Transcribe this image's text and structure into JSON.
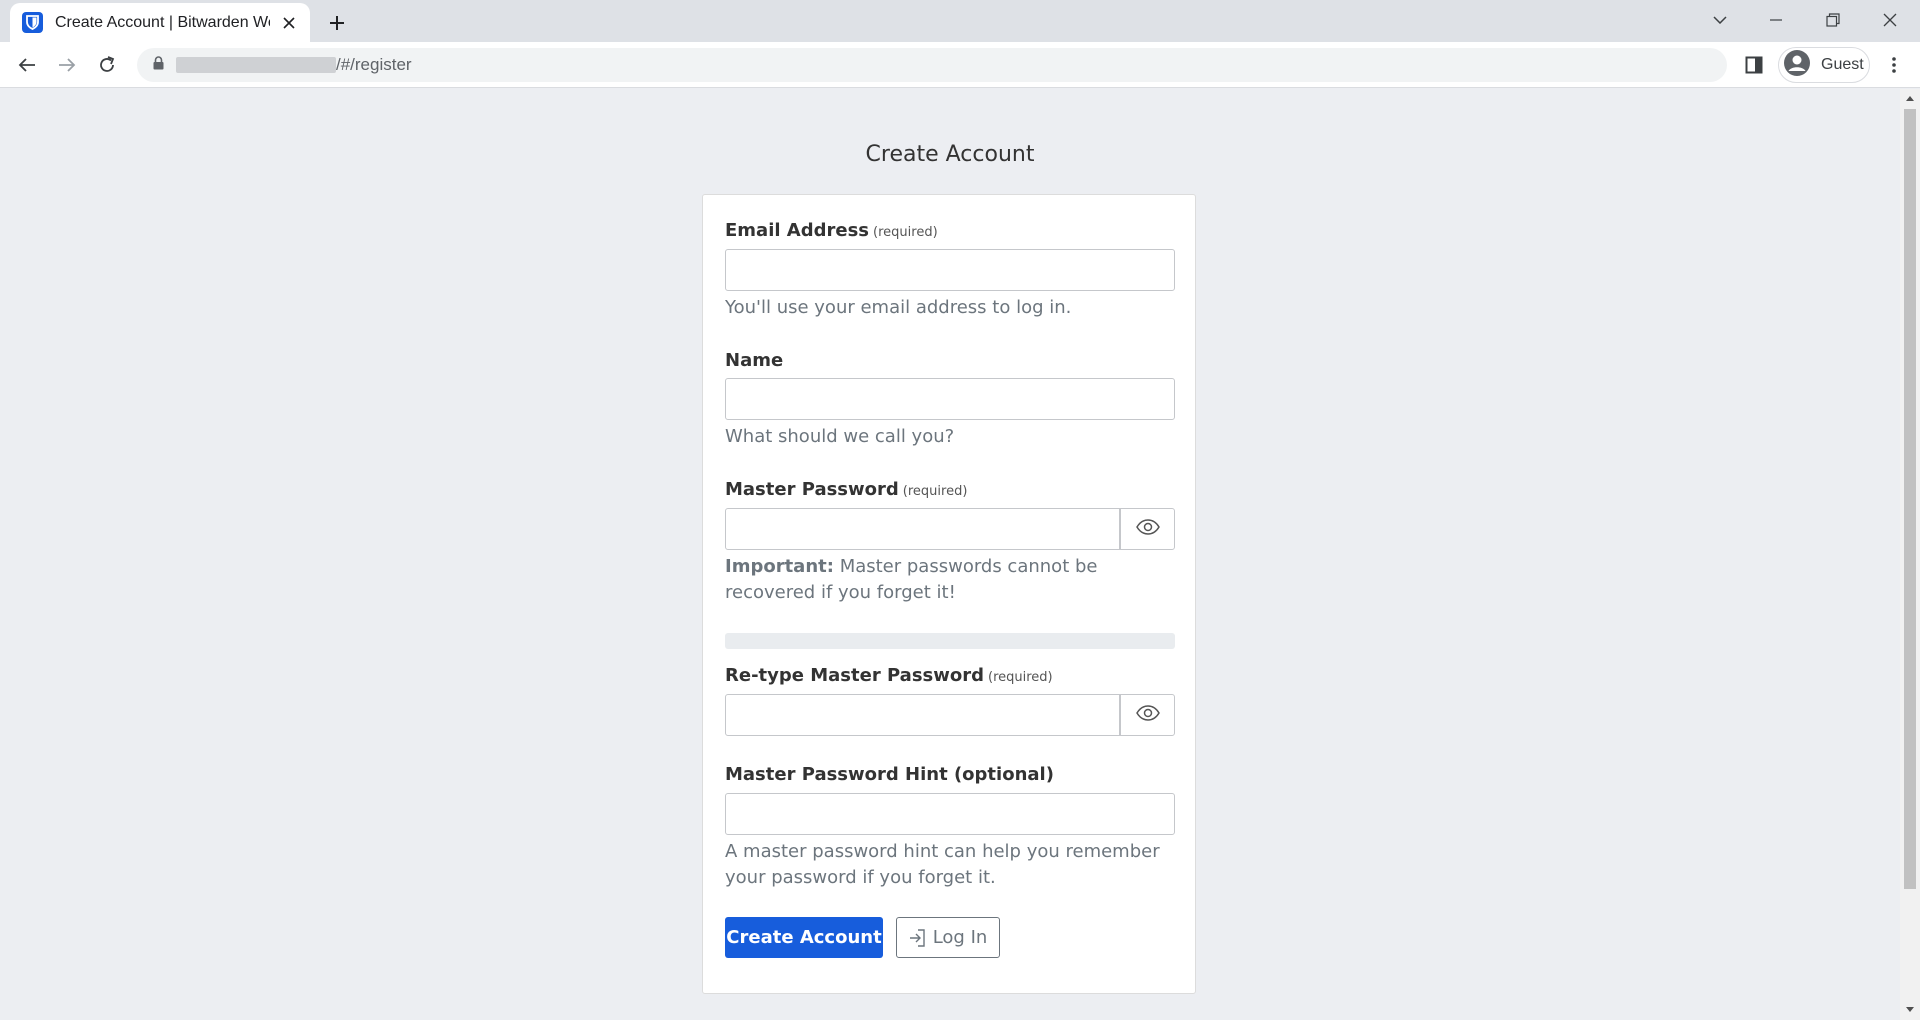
{
  "browser": {
    "tab_title": "Create Account | Bitwarden Web",
    "url_path": "/#/register",
    "profile_label": "Guest"
  },
  "page": {
    "title": "Create Account"
  },
  "form": {
    "email_label": "Email Address",
    "email_required": "(required)",
    "email_value": "",
    "email_help": "You'll use your email address to log in.",
    "name_label": "Name",
    "name_value": "",
    "name_help": "What should we call you?",
    "master_password_label": "Master Password",
    "master_password_required": "(required)",
    "master_password_value": "",
    "master_password_help_strong": "Important:",
    "master_password_help": "Master passwords cannot be recovered if you forget it!",
    "password_strength": 0,
    "retype_label": "Re-type Master Password",
    "retype_required": "(required)",
    "retype_value": "",
    "hint_label": "Master Password Hint (optional)",
    "hint_value": "",
    "hint_help": "A master password hint can help you remember your password if you forget it.",
    "create_button": "Create Account",
    "login_button": "Log In"
  },
  "colors": {
    "primary": "#175ddc",
    "background": "#eceef2",
    "muted_text": "#6c757d"
  }
}
